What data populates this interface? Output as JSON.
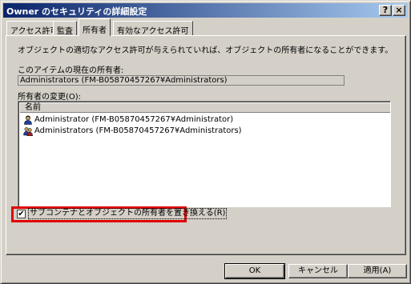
{
  "window": {
    "title": "Owner のセキュリティの詳細設定",
    "help_button": "?",
    "close_button": "×"
  },
  "tabs": [
    {
      "label": "アクセス許可"
    },
    {
      "label": "監査"
    },
    {
      "label": "所有者"
    },
    {
      "label": "有効なアクセス許可"
    }
  ],
  "owner_panel": {
    "description": "オブジェクトの適切なアクセス許可が与えられていれば、オブジェクトの所有者になることができます。",
    "current_owner_label": "このアイテムの現在の所有者:",
    "current_owner_value": "Administrators (FM-B05870457267¥Administrators)",
    "change_owner_label": "所有者の変更(O):",
    "list_header": "名前",
    "list_items": [
      {
        "label": "Administrator (FM-B05870457267¥Administrator)",
        "icon": "user-icon"
      },
      {
        "label": "Administrators (FM-B05870457267¥Administrators)",
        "icon": "group-icon"
      }
    ],
    "replace_checkbox_label": "サブコンテナとオブジェクトの所有者を置き換える(R)",
    "replace_checked": true,
    "highlight_color": "#e00000"
  },
  "buttons": {
    "ok": "OK",
    "cancel": "キャンセル",
    "apply": "適用(A)"
  }
}
